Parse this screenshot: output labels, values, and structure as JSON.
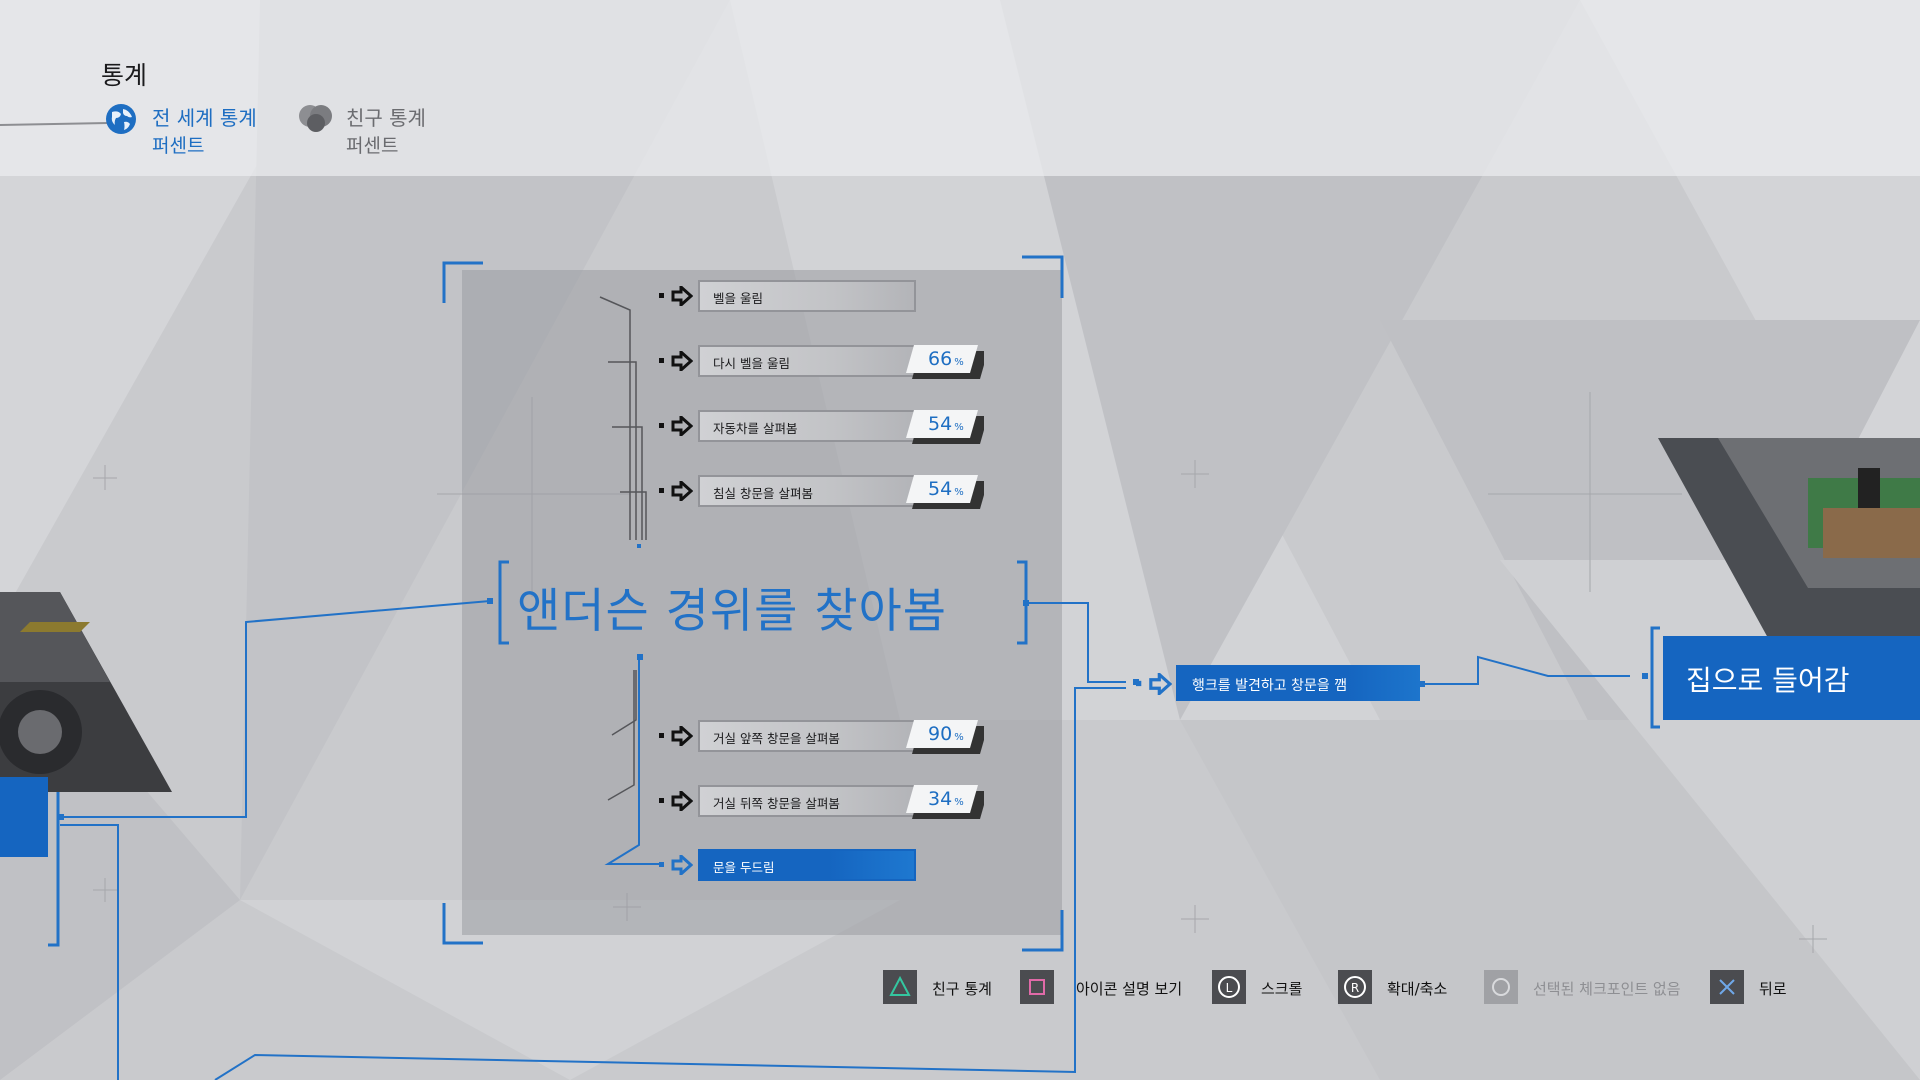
{
  "header": {
    "title": "통계",
    "tabs": [
      {
        "label": "전 세계 통계",
        "sub": "퍼센트",
        "icon": "globe-icon",
        "active": true
      },
      {
        "label": "친구 통계",
        "sub": "퍼센트",
        "icon": "friends-icon",
        "active": false
      }
    ]
  },
  "flow": {
    "main_title": "앤더슨 경위를 찾아봄",
    "branches_top": [
      {
        "label": "벨을 울림",
        "percent": null
      },
      {
        "label": "다시 벨을 울림",
        "percent": "66"
      },
      {
        "label": "자동차를 살펴봄",
        "percent": "54"
      },
      {
        "label": "침실 창문을 살펴봄",
        "percent": "54"
      }
    ],
    "branches_bottom": [
      {
        "label": "거실 앞쪽 창문을 살펴봄",
        "percent": "90"
      },
      {
        "label": "거실 뒤쪽 창문을 살펴봄",
        "percent": "34"
      },
      {
        "label": "문을 두드림",
        "percent": null,
        "selected": true
      }
    ],
    "percent_unit": "%",
    "mid_node": "행크를 발견하고 창문을 깸",
    "right_node": "집으로 들어감"
  },
  "footer": [
    {
      "button": "triangle",
      "label": "친구 통계"
    },
    {
      "button": "square",
      "label": "아이콘 설명 보기"
    },
    {
      "button": "L-stick",
      "label": "스크롤"
    },
    {
      "button": "R-stick",
      "label": "확대/축소"
    },
    {
      "button": "circle",
      "label": "선택된 체크포인트 없음",
      "disabled": true
    },
    {
      "button": "cross",
      "label": "뒤로"
    }
  ],
  "colors": {
    "accent": "#1565c0",
    "accent_text": "#2272c7",
    "background": "#c9cacd"
  }
}
